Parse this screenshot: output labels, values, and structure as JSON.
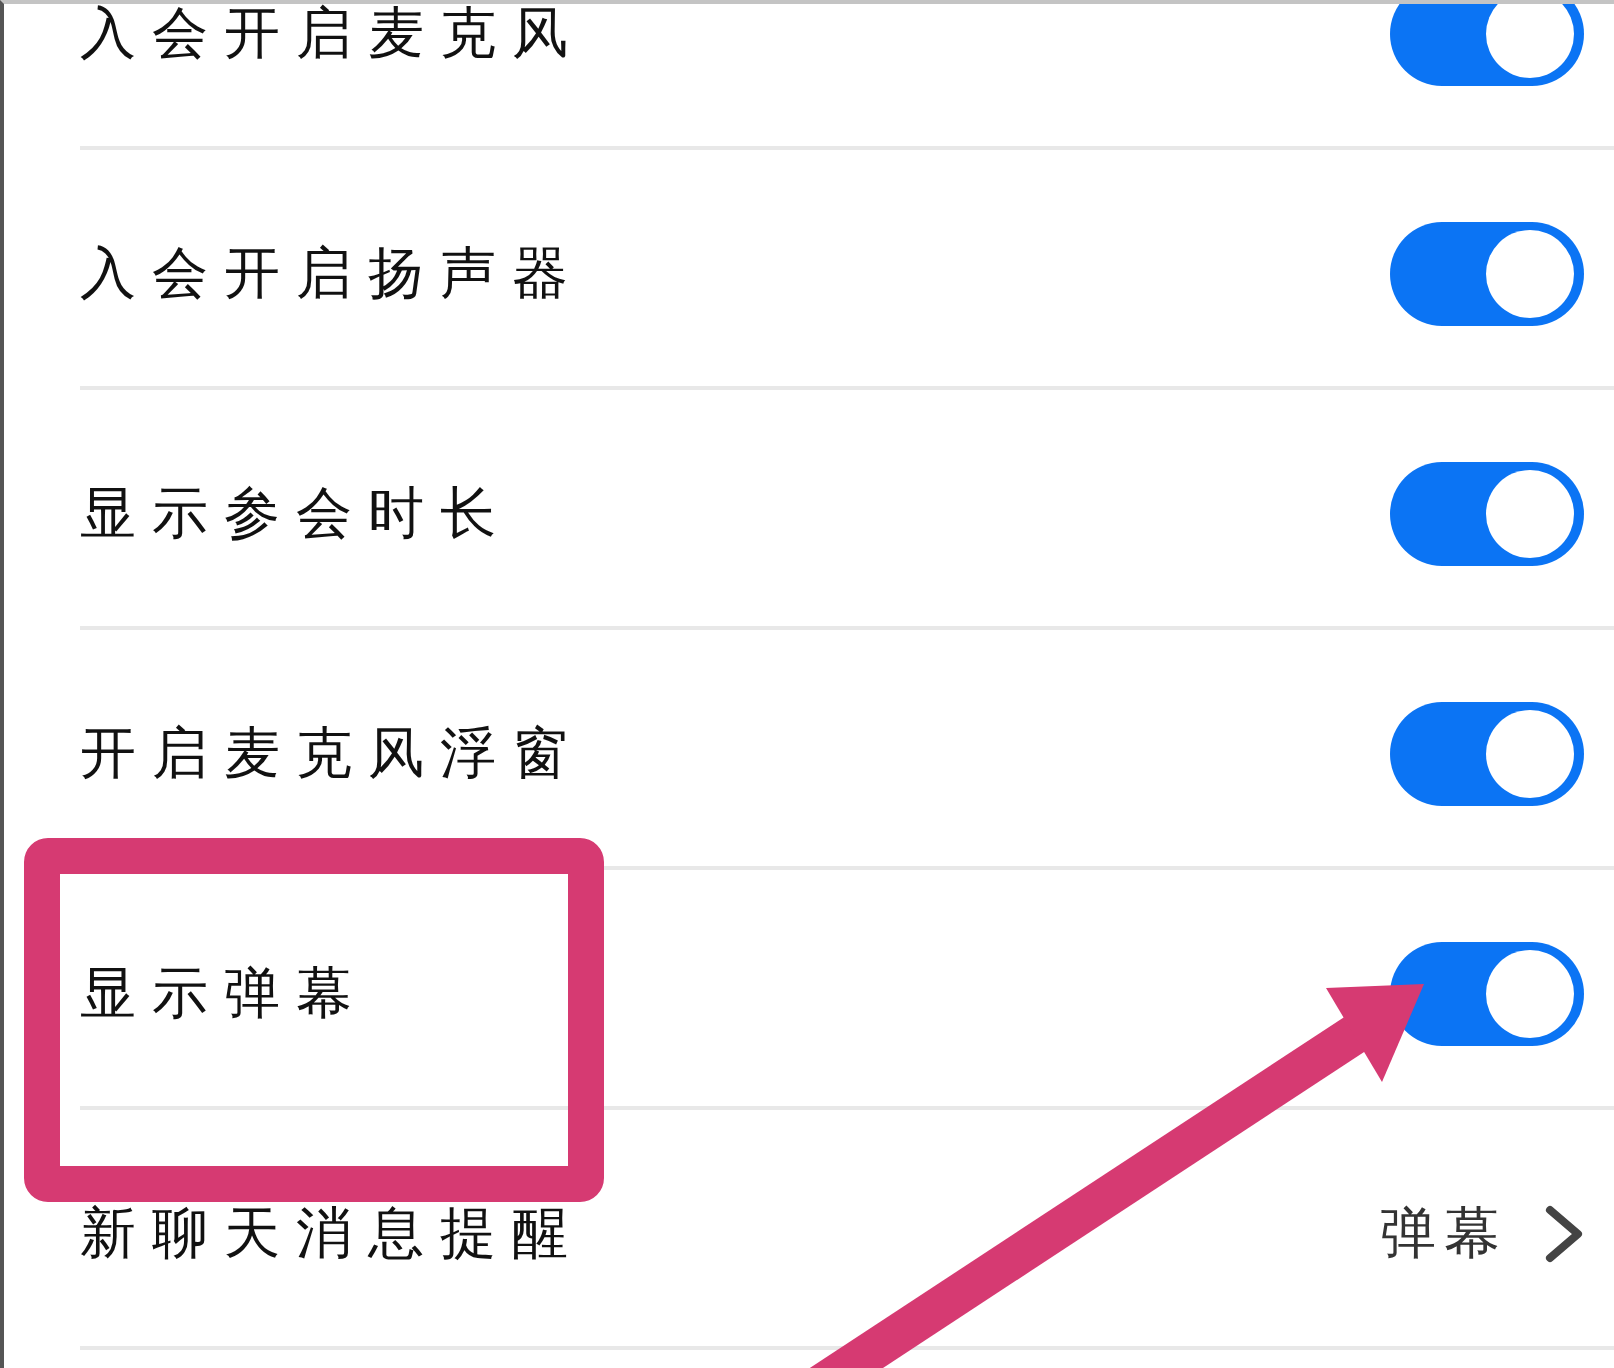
{
  "settings": [
    {
      "kind": "toggle",
      "label": "入会开启麦克风",
      "on": true,
      "highlighted": false
    },
    {
      "kind": "toggle",
      "label": "入会开启扬声器",
      "on": true,
      "highlighted": false
    },
    {
      "kind": "toggle",
      "label": "显示参会时长",
      "on": true,
      "highlighted": false
    },
    {
      "kind": "toggle",
      "label": "开启麦克风浮窗",
      "on": true,
      "highlighted": false
    },
    {
      "kind": "toggle",
      "label": "显示弹幕",
      "on": true,
      "highlighted": true
    },
    {
      "kind": "link",
      "label": "新聊天消息提醒",
      "value": "弹幕",
      "highlighted": false
    }
  ]
}
